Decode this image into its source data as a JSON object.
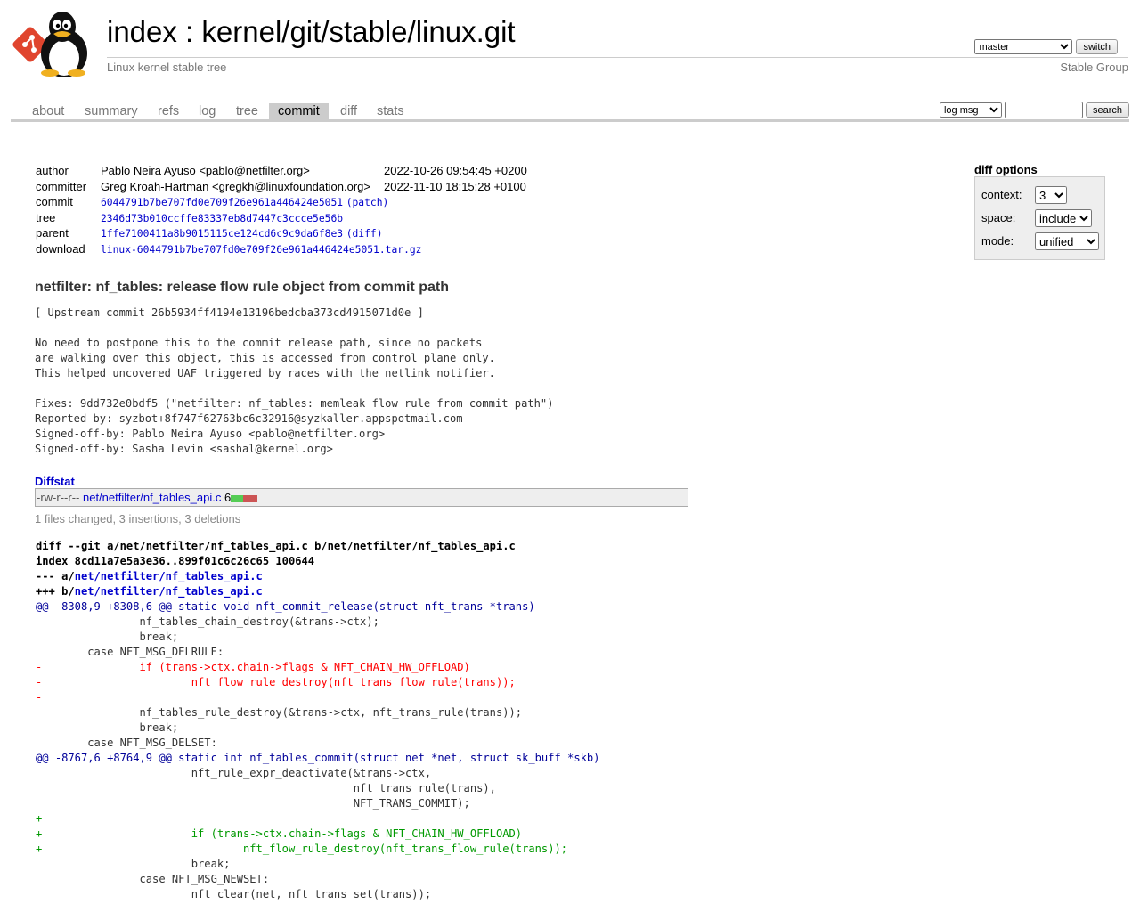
{
  "header": {
    "index_link": "index",
    "separator": " : ",
    "repo_path": "kernel/git/stable/linux.git",
    "description": "Linux kernel stable tree",
    "owner": "Stable Group",
    "branch_selected": "master",
    "switch_label": "switch"
  },
  "tabs": [
    {
      "label": "about"
    },
    {
      "label": "summary"
    },
    {
      "label": "refs"
    },
    {
      "label": "log"
    },
    {
      "label": "tree"
    },
    {
      "label": "commit",
      "active": true
    },
    {
      "label": "diff"
    },
    {
      "label": "stats"
    }
  ],
  "search": {
    "mode_selected": "log msg",
    "query": "",
    "button_label": "search"
  },
  "commit_info": {
    "author_label": "author",
    "author": "Pablo Neira Ayuso <pablo@netfilter.org>",
    "author_date": "2022-10-26 09:54:45 +0200",
    "committer_label": "committer",
    "committer": "Greg Kroah-Hartman <gregkh@linuxfoundation.org>",
    "committer_date": "2022-11-10 18:15:28 +0100",
    "commit_label": "commit",
    "commit_sha": "6044791b7be707fd0e709f26e961a446424e5051",
    "commit_extra": "(patch)",
    "tree_label": "tree",
    "tree_sha": "2346d73b010ccffe83337eb8d7447c3ccce5e56b",
    "parent_label": "parent",
    "parent_sha": "1ffe7100411a8b9015115ce124cd6c9c9da6f8e3",
    "parent_extra": "(diff)",
    "download_label": "download",
    "download_file": "linux-6044791b7be707fd0e709f26e961a446424e5051.tar.gz"
  },
  "diff_options": {
    "title": "diff options",
    "context_label": "context:",
    "context_value": "3",
    "space_label": "space:",
    "space_value": "include",
    "mode_label": "mode:",
    "mode_value": "unified"
  },
  "subject": "netfilter: nf_tables: release flow rule object from commit path",
  "message": "[ Upstream commit 26b5934ff4194e13196bedcba373cd4915071d0e ]\n\nNo need to postpone this to the commit release path, since no packets\nare walking over this object, this is accessed from control plane only.\nThis helped uncovered UAF triggered by races with the netlink notifier.\n\nFixes: 9dd732e0bdf5 (\"netfilter: nf_tables: memleak flow rule from commit path\")\nReported-by: syzbot+8f747f62763bc6c32916@syzkaller.appspotmail.com\nSigned-off-by: Pablo Neira Ayuso <pablo@netfilter.org>\nSigned-off-by: Sasha Levin <sashal@kernel.org>",
  "diffstat": {
    "title": "Diffstat",
    "mode": "-rw-r--r--",
    "file": "net/netfilter/nf_tables_api.c",
    "count": "6",
    "summary": "1 files changed, 3 insertions, 3 deletions"
  },
  "diff": {
    "line1_prefix": "diff --git a/",
    "line1_mid": " b/",
    "file": "net/netfilter/nf_tables_api.c",
    "index_line": "index 8cd11a7e5a3e36..899f01c6c26c65 100644",
    "minus_prefix": "--- a/",
    "plus_prefix": "+++ b/",
    "lines": [
      {
        "type": "hunk",
        "text": "@@ -8308,9 +8308,6 @@ static void nft_commit_release(struct nft_trans *trans)"
      },
      {
        "type": "ctx",
        "text": " \t\tnf_tables_chain_destroy(&trans->ctx);"
      },
      {
        "type": "ctx",
        "text": " \t\tbreak;"
      },
      {
        "type": "ctx",
        "text": " \tcase NFT_MSG_DELRULE:"
      },
      {
        "type": "del",
        "text": "-\t\tif (trans->ctx.chain->flags & NFT_CHAIN_HW_OFFLOAD)"
      },
      {
        "type": "del",
        "text": "-\t\t\tnft_flow_rule_destroy(nft_trans_flow_rule(trans));"
      },
      {
        "type": "del",
        "text": "-"
      },
      {
        "type": "ctx",
        "text": " \t\tnf_tables_rule_destroy(&trans->ctx, nft_trans_rule(trans));"
      },
      {
        "type": "ctx",
        "text": " \t\tbreak;"
      },
      {
        "type": "ctx",
        "text": " \tcase NFT_MSG_DELSET:"
      },
      {
        "type": "hunk",
        "text": "@@ -8767,6 +8764,9 @@ static int nf_tables_commit(struct net *net, struct sk_buff *skb)"
      },
      {
        "type": "ctx",
        "text": " \t\t\tnft_rule_expr_deactivate(&trans->ctx,"
      },
      {
        "type": "ctx",
        "text": " \t\t\t\t\t\t nft_trans_rule(trans),"
      },
      {
        "type": "ctx",
        "text": " \t\t\t\t\t\t NFT_TRANS_COMMIT);"
      },
      {
        "type": "add",
        "text": "+"
      },
      {
        "type": "add",
        "text": "+\t\t\tif (trans->ctx.chain->flags & NFT_CHAIN_HW_OFFLOAD)"
      },
      {
        "type": "add",
        "text": "+\t\t\t\tnft_flow_rule_destroy(nft_trans_flow_rule(trans));"
      },
      {
        "type": "ctx",
        "text": " \t\t\tbreak;"
      },
      {
        "type": "ctx",
        "text": " \t\tcase NFT_MSG_NEWSET:"
      },
      {
        "type": "ctx",
        "text": " \t\t\tnft_clear(net, nft_trans_set(trans));"
      }
    ]
  },
  "colors": {
    "link": "#0000cc",
    "added": "#009900",
    "deleted": "#ff0000",
    "hunk": "#000099",
    "logo_red": "#e0452e"
  }
}
